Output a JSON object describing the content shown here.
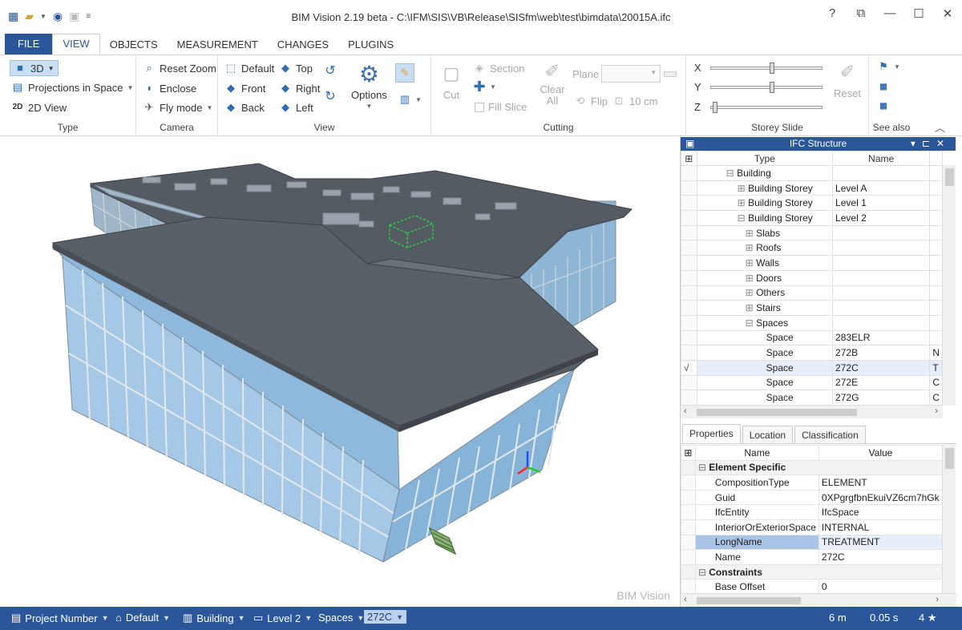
{
  "window": {
    "title": "BIM Vision 2.19 beta - C:\\IFM\\SIS\\VB\\Release\\SISfm\\web\\test\\bimdata\\20015A.ifc",
    "help": "?",
    "restore": "⧉",
    "minimize": "—",
    "maximize": "☐",
    "close": "✕"
  },
  "tabs": [
    "FILE",
    "VIEW",
    "OBJECTS",
    "MEASUREMENT",
    "CHANGES",
    "PLUGINS"
  ],
  "ribbon": {
    "type": {
      "label": "Type",
      "btn3d": "3D",
      "projections": "Projections in Space",
      "view2d": "2D View",
      "icon2d": "2D"
    },
    "camera": {
      "label": "Camera",
      "reset_zoom": "Reset Zoom",
      "enclose": "Enclose",
      "fly_mode": "Fly mode"
    },
    "view": {
      "label": "View",
      "default": "Default",
      "top": "Top",
      "front": "Front",
      "right": "Right",
      "back": "Back",
      "left": "Left",
      "options": "Options"
    },
    "cutting": {
      "label": "Cutting",
      "cut": "Cut",
      "section": "Section",
      "fill_slice": "Fill Slice",
      "clear_all": "Clear All",
      "plane": "Plane",
      "flip": "Flip",
      "thickness": "10 cm"
    },
    "storey": {
      "label": "Storey Slide",
      "x": "X",
      "y": "Y",
      "z": "Z",
      "reset": "Reset",
      "x_level": 0.55,
      "y_level": 0.55,
      "z_level": 0.02
    },
    "seealso": {
      "label": "See also"
    }
  },
  "viewport": {
    "watermark": "BIM Vision"
  },
  "ifc_structure": {
    "title": "IFC Structure",
    "col_type": "Type",
    "col_name": "Name",
    "rows": [
      {
        "check": "",
        "type": "Building",
        "name": "",
        "extra": ""
      },
      {
        "check": "",
        "type": "Building Storey",
        "name": "Level A",
        "extra": ""
      },
      {
        "check": "",
        "type": "Building Storey",
        "name": "Level 1",
        "extra": ""
      },
      {
        "check": "",
        "type": "Building Storey",
        "name": "Level 2",
        "extra": ""
      },
      {
        "check": "",
        "type": "Slabs",
        "name": "",
        "extra": ""
      },
      {
        "check": "",
        "type": "Roofs",
        "name": "",
        "extra": ""
      },
      {
        "check": "",
        "type": "Walls",
        "name": "",
        "extra": ""
      },
      {
        "check": "",
        "type": "Doors",
        "name": "",
        "extra": ""
      },
      {
        "check": "",
        "type": "Others",
        "name": "",
        "extra": ""
      },
      {
        "check": "",
        "type": "Stairs",
        "name": "",
        "extra": ""
      },
      {
        "check": "",
        "type": "Spaces",
        "name": "",
        "extra": ""
      },
      {
        "check": "",
        "type": "Space",
        "name": "283ELR",
        "extra": ""
      },
      {
        "check": "",
        "type": "Space",
        "name": "272B",
        "extra": "N"
      },
      {
        "check": "√",
        "type": "Space",
        "name": "272C",
        "extra": "T"
      },
      {
        "check": "",
        "type": "Space",
        "name": "272E",
        "extra": "C"
      },
      {
        "check": "",
        "type": "Space",
        "name": "272G",
        "extra": "C"
      }
    ]
  },
  "props_tabs": [
    "Properties",
    "Location",
    "Classification"
  ],
  "properties": {
    "col_name": "Name",
    "col_value": "Value",
    "rows": [
      {
        "cat": true,
        "name": "Element Specific",
        "value": ""
      },
      {
        "cat": false,
        "name": "CompositionType",
        "value": "ELEMENT"
      },
      {
        "cat": false,
        "name": "Guid",
        "value": "0XPgrgfbnEkuiVZ6cm7hGk"
      },
      {
        "cat": false,
        "name": "IfcEntity",
        "value": "IfcSpace"
      },
      {
        "cat": false,
        "name": "InteriorOrExteriorSpace",
        "value": "INTERNAL"
      },
      {
        "cat": false,
        "name": "LongName",
        "value": "TREATMENT"
      },
      {
        "cat": false,
        "name": "Name",
        "value": "272C"
      },
      {
        "cat": true,
        "name": "Constraints",
        "value": ""
      },
      {
        "cat": false,
        "name": "Base Offset",
        "value": "0"
      }
    ]
  },
  "statusbar": {
    "project": "Project Number",
    "default": "Default",
    "building": "Building",
    "level": "Level 2",
    "spaces": "Spaces",
    "selected": "272C",
    "distance": "6 m",
    "time": "0.05 s",
    "rating": "4 ★"
  }
}
